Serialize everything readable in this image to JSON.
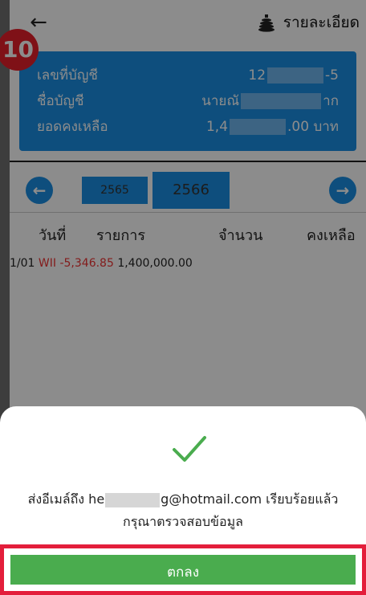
{
  "header": {
    "detail_label": "รายละเอียด"
  },
  "badge": {
    "text": "10"
  },
  "account": {
    "number_label": "เลขที่บัญชี",
    "number_prefix": "12",
    "number_suffix": "-5",
    "name_label": "ชื่อบัญชี",
    "name_prefix": "นายณั",
    "name_suffix": "าก",
    "balance_label": "ยอดคงเหลือ",
    "balance_prefix": "1,4",
    "balance_suffix": ".00 บาท"
  },
  "years": {
    "previous": "2565",
    "current": "2566"
  },
  "table": {
    "headers": [
      "วันที่",
      "รายการ",
      "จำนวน",
      "คงเหลือ"
    ],
    "rows": [
      {
        "date": "1/01",
        "item": "WII",
        "amount": "-5,346.85",
        "balance": "1,400,000.00"
      }
    ]
  },
  "dialog": {
    "message_prefix": "ส่งอีเมล์ถึง he",
    "message_suffix": "g@hotmail.com เรียบร้อยแล้ว กรุณาตรวจสอบข้อมูล",
    "ok_label": "ตกลง",
    "check_color": "#4aac4e"
  },
  "colors": {
    "accent": "#1a8fe3",
    "negative": "#e33333",
    "highlight_frame": "#e31e3b"
  }
}
